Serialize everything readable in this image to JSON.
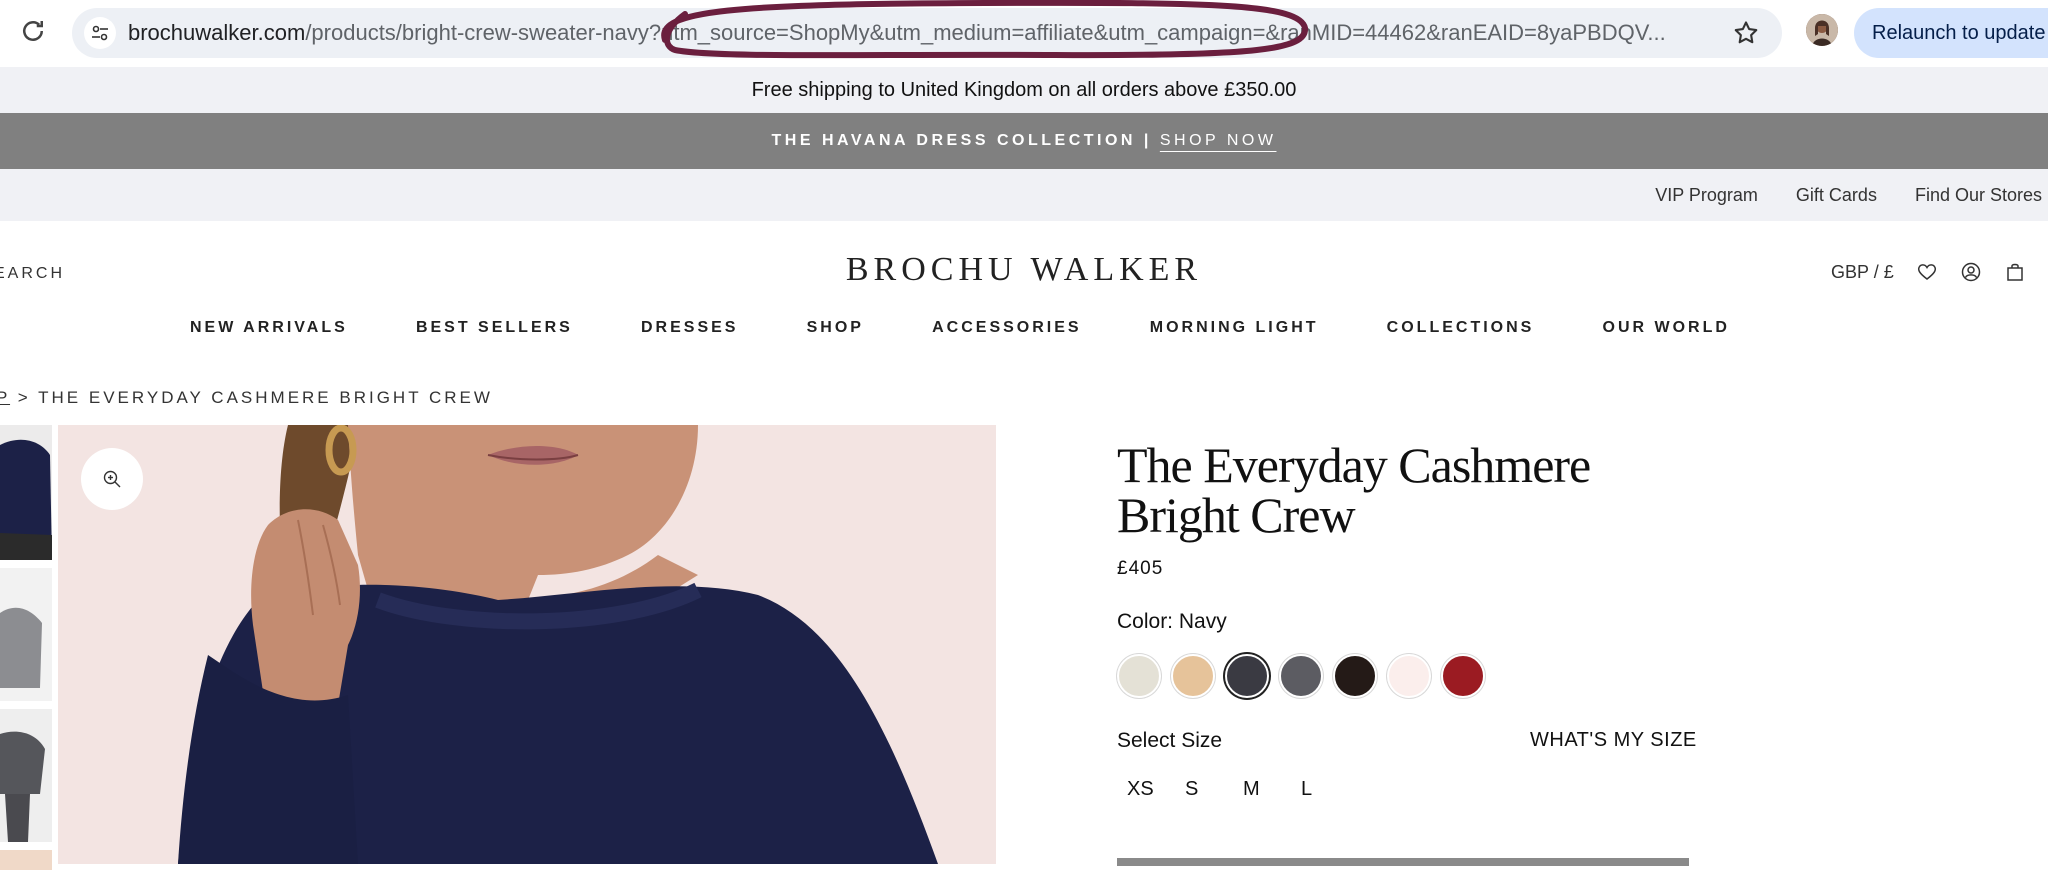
{
  "browser": {
    "url_domain": "brochuwalker.com",
    "url_path": "/products/bright-crew-sweater-navy?utm_source=ShopMy&utm_medium=affiliate&utm_campaign=&ranMID=44462&ranEAID=8yaPBDQV...",
    "relaunch_label": "Relaunch to update"
  },
  "shipping_notice": "Free shipping to United Kingdom on all orders above £350.00",
  "promo": {
    "text": "THE HAVANA DRESS COLLECTION",
    "separator": "|",
    "link": "SHOP NOW"
  },
  "utility_nav": [
    "VIP Program",
    "Gift Cards",
    "Find Our Stores"
  ],
  "header": {
    "search_label": "EARCH",
    "logo": "BROCHU WALKER",
    "currency": "GBP / £"
  },
  "main_nav": [
    "NEW ARRIVALS",
    "BEST SELLERS",
    "DRESSES",
    "SHOP",
    "ACCESSORIES",
    "MORNING LIGHT",
    "COLLECTIONS",
    "OUR WORLD"
  ],
  "breadcrumb": {
    "link": "P",
    "separator": ">",
    "current": "THE EVERYDAY CASHMERE BRIGHT CREW"
  },
  "product": {
    "title_line1": "The Everyday Cashmere",
    "title_line2": "Bright Crew",
    "price": "£405",
    "color_label": "Color: Navy",
    "swatches": [
      {
        "color": "#e4e1d6"
      },
      {
        "color": "#e6c39a"
      },
      {
        "color": "#3a3a42",
        "selected": true
      },
      {
        "color": "#5c5c62"
      },
      {
        "color": "#241a17"
      },
      {
        "color": "#fbeeec"
      },
      {
        "color": "#9b1b22"
      }
    ],
    "select_size_label": "Select Size",
    "whats_my_size": "WHAT'S MY SIZE",
    "sizes": [
      "XS",
      "S",
      "M",
      "L"
    ]
  },
  "colors": {
    "annotation_circle": "#6b1f3e",
    "promo_bg": "#808080",
    "sweater": "#1c2147"
  }
}
